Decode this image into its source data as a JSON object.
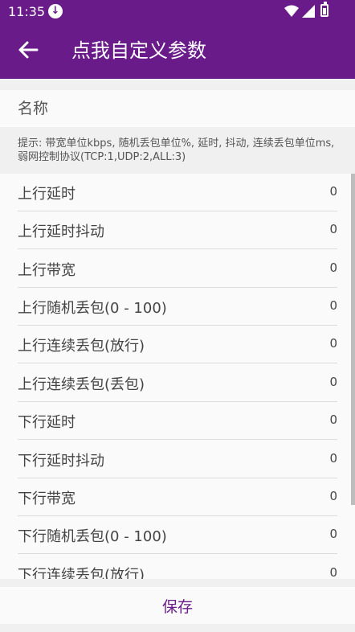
{
  "status_bar": {
    "time": "11:35"
  },
  "app_bar": {
    "title": "点我自定义参数"
  },
  "name_field": {
    "placeholder": "名称",
    "value": ""
  },
  "hint": "提示: 带宽单位kbps, 随机丢包单位%, 延时, 抖动, 连续丢包单位ms, 弱网控制协议(TCP:1,UDP:2,ALL:3)",
  "params": [
    {
      "label": "上行延时",
      "value": "0"
    },
    {
      "label": "上行延时抖动",
      "value": "0"
    },
    {
      "label": "上行带宽",
      "value": "0"
    },
    {
      "label": "上行随机丢包(0 - 100)",
      "value": "0"
    },
    {
      "label": "上行连续丢包(放行)",
      "value": "0"
    },
    {
      "label": "上行连续丢包(丢包)",
      "value": "0"
    },
    {
      "label": "下行延时",
      "value": "0"
    },
    {
      "label": "下行延时抖动",
      "value": "0"
    },
    {
      "label": "下行带宽",
      "value": "0"
    },
    {
      "label": "下行随机丢包(0 - 100)",
      "value": "0"
    },
    {
      "label": "下行连续丢包(放行)",
      "value": "0"
    }
  ],
  "save_label": "保存",
  "colors": {
    "primary": "#6a1b8a",
    "background": "#f0f0f0",
    "surface": "#fafafa"
  },
  "icons": [
    "download-icon",
    "wifi-icon",
    "signal-icon",
    "battery-icon",
    "back-arrow-icon"
  ]
}
